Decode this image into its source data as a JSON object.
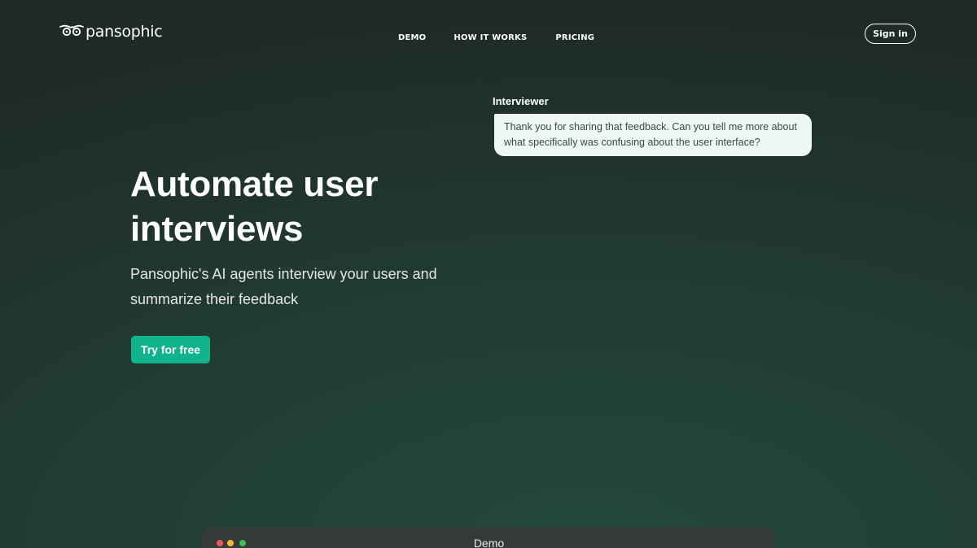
{
  "header": {
    "logo_text": "pansophic",
    "logo_icon": "owl-eyes-icon",
    "nav": {
      "demo": "DEMO",
      "how_it_works": "HOW IT WORKS",
      "pricing": "PRICING"
    },
    "sign_in": "Sign in"
  },
  "hero": {
    "title": "Automate user interviews",
    "subtitle": "Pansophic's AI agents interview your users and summarize their feedback",
    "cta": "Try for free"
  },
  "chat": {
    "speaker": "Interviewer",
    "message": "Thank you for sharing that feedback. Can you tell me more about what specifically was confusing about the user interface?"
  },
  "demo_window": {
    "title": "Demo"
  },
  "colors": {
    "accent": "#10b38c",
    "background": "#1f2b27",
    "bubble": "#eef7f3"
  }
}
